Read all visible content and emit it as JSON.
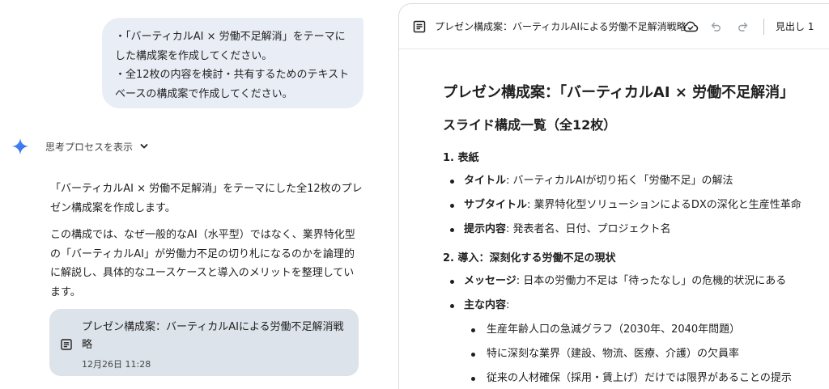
{
  "chat": {
    "user_message": [
      "・「バーティカルAI × 労働不足解消」をテーマにした構成案を作成してください。",
      "・全12枚の内容を検討・共有するためのテキストベースの構成案で作成してください。"
    ],
    "thought_toggle": "思考プロセスを表示",
    "answer_paragraphs": [
      "「バーティカルAI × 労働不足解消」をテーマにした全12枚のプレゼン構成案を作成します。",
      "この構成では、なぜ一般的なAI（水平型）ではなく、業界特化型の「バーティカルAI」が労働力不足の切り札になるのかを論理的に解説し、具体的なユースケースと導入のメリットを整理しています。"
    ],
    "doc_card": {
      "title": "プレゼン構成案：バーティカルAIによる労働不足解消戦略",
      "date": "12月26日 11:28"
    }
  },
  "canvas": {
    "toolbar": {
      "title": "プレゼン構成案：バーティカルAIによる労働不足解消戦略",
      "heading_select": "見出し 1"
    },
    "doc": {
      "h1": "プレゼン構成案：「バーティカルAI × 労働不足解消」",
      "h2": "スライド構成一覧（全12枚）",
      "sections": [
        {
          "heading": "1. 表紙",
          "items": [
            {
              "label": "タイトル",
              "text": ": バーティカルAIが切り拓く「労働不足」の解法"
            },
            {
              "label": "サブタイトル",
              "text": ": 業界特化型ソリューションによるDXの深化と生産性革命"
            },
            {
              "label": "提示内容",
              "text": ": 発表者名、日付、プロジェクト名"
            }
          ]
        },
        {
          "heading": "2. 導入：深刻化する労働不足の現状",
          "items": [
            {
              "label": "メッセージ",
              "text": ": 日本の労働力不足は「待ったなし」の危機的状況にある"
            },
            {
              "label": "主な内容",
              "text": ":"
            }
          ],
          "subitems": [
            "生産年齢人口の急減グラフ（2030年、2040年問題）",
            "特に深刻な業界（建設、物流、医療、介護）の欠員率",
            "従来の人材確保（採用・賃上げ）だけでは限界があることの提示"
          ]
        }
      ]
    }
  }
}
